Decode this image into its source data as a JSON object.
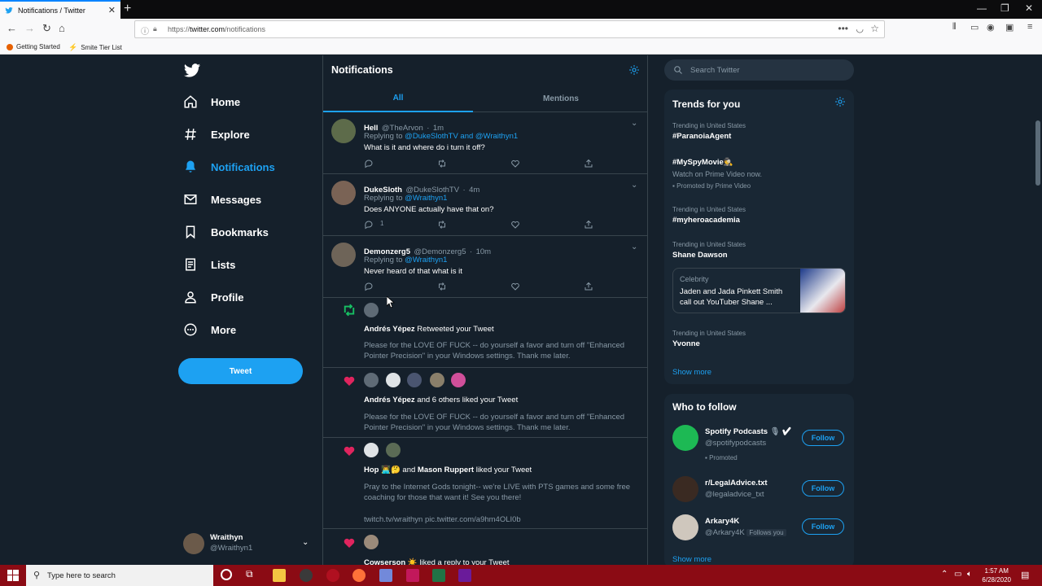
{
  "browser": {
    "tab_title": "Notifications / Twitter",
    "url_prefix": "https://",
    "url_host": "twitter.com",
    "url_path": "/notifications",
    "bookmarks": [
      "Getting Started",
      "Smite Tier List"
    ]
  },
  "nav": {
    "items": [
      "Home",
      "Explore",
      "Notifications",
      "Messages",
      "Bookmarks",
      "Lists",
      "Profile",
      "More"
    ],
    "tweet_button": "Tweet",
    "account_name": "Wraithyn",
    "account_handle": "@Wraithyn1"
  },
  "main": {
    "title": "Notifications",
    "tabs": [
      "All",
      "Mentions"
    ],
    "tweets": [
      {
        "name": "Hell",
        "handle": "@TheArvon",
        "time": "1m",
        "replying_label": "Replying to",
        "replying_to": "@DukeSlothTV and @Wraithyn1",
        "text": "What is it and where do i turn it off?",
        "reply_count": ""
      },
      {
        "name": "DukeSloth",
        "handle": "@DukeSlothTV",
        "time": "4m",
        "replying_label": "Replying to",
        "replying_to": "@Wraithyn1",
        "text": "Does ANYONE actually have that on?",
        "reply_count": "1"
      },
      {
        "name": "Demonzerg5",
        "handle": "@Demonzerg5",
        "time": "10m",
        "replying_label": "Replying to",
        "replying_to": "@Wraithyn1",
        "text": "Never heard of that what is it",
        "reply_count": ""
      }
    ],
    "notifications": [
      {
        "actor": "Andrés Yépez",
        "action": "Retweeted your Tweet",
        "text": "Please for the LOVE OF FUCK -- do yourself a favor and turn off \"Enhanced Pointer Precision\" in your Windows settings. Thank me later."
      },
      {
        "actor": "Andrés Yépez",
        "action": "and 6 others liked your Tweet",
        "text": "Please for the LOVE OF FUCK -- do yourself a favor and turn off \"Enhanced Pointer Precision\" in your Windows settings. Thank me later."
      },
      {
        "actor": "Hop",
        "and": "and",
        "actor2": "Mason Ruppert",
        "action": "liked your Tweet",
        "text": "Pray to the Internet Gods tonight-- we're LIVE with PTS games and some free coaching for those that want it! See you there!",
        "link": "twitch.tv/wraithyn pic.twitter.com/a9hm4OLI0b"
      },
      {
        "actor": "Cowserson",
        "action": "liked a reply to your Tweet"
      }
    ]
  },
  "right": {
    "search_placeholder": "Search Twitter",
    "trends_title": "Trends for you",
    "trends": [
      {
        "context": "Trending in United States",
        "name": "#ParanoiaAgent"
      },
      {
        "context": "",
        "name": "#MySpyMovie",
        "desc": "Watch on Prime Video now.",
        "promoted": "Promoted by Prime Video"
      },
      {
        "context": "Trending in United States",
        "name": "#myheroacademia"
      },
      {
        "context": "Trending in United States",
        "name": "Shane Dawson",
        "card_category": "Celebrity",
        "card_text": "Jaden and Jada Pinkett Smith call out YouTuber Shane ..."
      },
      {
        "context": "Trending in United States",
        "name": "Yvonne"
      }
    ],
    "show_more": "Show more",
    "wtf_title": "Who to follow",
    "follow": [
      {
        "name": "Spotify Podcasts",
        "handle": "@spotifypodcasts",
        "extra": "Promoted",
        "button": "Follow"
      },
      {
        "name": "r/LegalAdvice.txt",
        "handle": "@legaladvice_txt",
        "extra": "",
        "button": "Follow"
      },
      {
        "name": "Arkary4K",
        "handle": "@Arkary4K",
        "extra": "Follows you",
        "button": "Follow"
      }
    ],
    "show_more2": "Show more"
  },
  "taskbar": {
    "search_placeholder": "Type here to search",
    "time": "1:57 AM",
    "date": "6/28/2020"
  },
  "colors": {
    "accent": "#1da1f2",
    "bg": "#15202b",
    "panel": "#192734",
    "like": "#e0245e",
    "retweet": "#17bf63"
  }
}
